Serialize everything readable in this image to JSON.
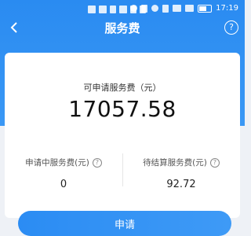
{
  "status_bar": {
    "time": "17:19"
  },
  "header": {
    "title": "服务费",
    "help": "?"
  },
  "summary": {
    "label": "可申请服务费（元）",
    "amount": "17057.58"
  },
  "stats": [
    {
      "label": "申请中服务费(元)",
      "value": "0",
      "info": "?"
    },
    {
      "label": "待结算服务费(元)",
      "value": "92.72",
      "info": "?"
    }
  ],
  "actions": {
    "apply_label": "申请"
  },
  "colors": {
    "primary": "#2a8bf1",
    "background": "#eef1f6",
    "card": "#ffffff"
  }
}
